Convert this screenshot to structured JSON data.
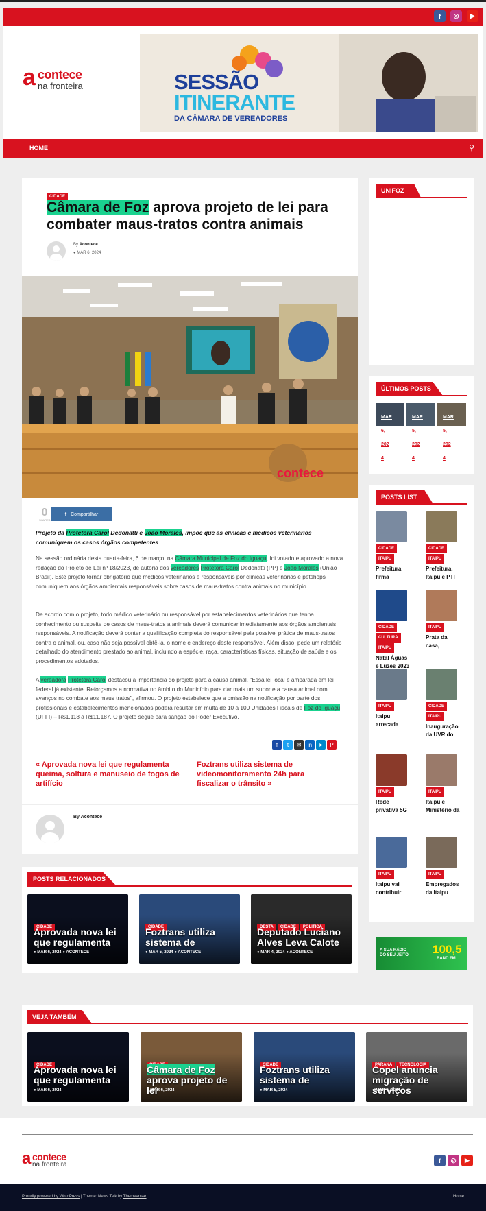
{
  "header": {
    "logo_line1": "contece",
    "logo_line2": "na fronteira",
    "banner": {
      "line1": "SESSÃO",
      "line2": "ITINERANTE",
      "line3": "DA CÂMARA DE VEREADORES"
    }
  },
  "nav": {
    "home": "HOME"
  },
  "article": {
    "category": "CIDADE",
    "title_hl": "Câmara de Foz",
    "title_rest": " aprova projeto de lei para combater maus-tratos contra animais",
    "author_prefix": "By",
    "author": "Acontece",
    "date": "MAR 6, 2024",
    "photo_watermark": "contece",
    "shares_count": "0",
    "shares_label": "SHARES",
    "share_button": "Compartilhar",
    "lead_1": "Projeto da ",
    "lead_hl1": "Protetora Carol",
    "lead_2": " Dedonatti e ",
    "lead_hl2": "João Morales",
    "lead_3": ", impõe que as clínicas e médicos veterinários comuniquem os casos órgãos competentes",
    "p1_a": "Na sessão ordinária desta quarta-feira, 6 de março, na ",
    "p1_hl1": "Câmara Municipal de Foz do Iguaçu",
    "p1_b": ", foi votado e aprovado a nova redação do Projeto de Lei nº 18/2023, de autoria dos ",
    "p1_hl2": "vereadores",
    "p1_hl3": "Protetora Carol",
    "p1_c": " Dedonatti (PP) e ",
    "p1_hl4": "João Morales",
    "p1_d": " (União Brasil). Este projeto tornar obrigatório que médicos veterinários e responsáveis por clínicas veterinárias e petshops comuniquem aos órgãos ambientais responsáveis sobre casos de maus-tratos contra animais no município.",
    "p2": "De acordo com o projeto, todo médico veterinário ou responsável por estabelecimentos veterinários que tenha conhecimento ou suspeite de casos de maus-tratos a animais deverá comunicar imediatamente aos órgãos ambientais responsáveis. A notificação deverá conter a qualificação completa do responsável pela possível prática de maus-tratos contra o animal, ou, caso não seja possível obtê-la, o nome e endereço deste responsável. Além disso, pede um relatório detalhado do atendimento prestado ao animal, incluindo a espécie, raça, características físicas, situação de saúde e os procedimentos adotados.",
    "p3_a": "A ",
    "p3_hl1": "vereadora",
    "p3_hl2": "Protetora Carol",
    "p3_b": " destacou a importância do projeto para a causa animal. \"Essa lei local é amparada em lei federal já existente. Reforçamos a normativa no âmbito do Município para dar mais um suporte a causa animal com avanços no combate aos maus tratos\", afirmou. O projeto estabelece que a omissão na notificação por parte dos profissionais e estabelecimentos mencionados poderá resultar em multa de 10 a 100 Unidades Fiscais de ",
    "p3_hl3": "Foz do Iguaçu",
    "p3_c": " (UFFI) – R$1.118 a R$11.187. O projeto segue para sanção do Poder Executivo.",
    "prev_link": "« Aprovada nova lei que regulamenta queima, soltura e manuseio de fogos de artifício",
    "next_link": "Foztrans utiliza sistema de videomonitoramento 24h para fiscalizar o trânsito »",
    "author_box": "By Acontece"
  },
  "sidebar": {
    "unifoz_title": "UNIFOZ",
    "ultimos_title": "ÚLTIMOS POSTS",
    "ultimos": [
      {
        "d1": "MAR",
        "d2": "6,",
        "d3": "202",
        "d4": "4"
      },
      {
        "d1": "MAR",
        "d2": "5,",
        "d3": "202",
        "d4": "4"
      },
      {
        "d1": "MAR",
        "d2": "5,",
        "d3": "202",
        "d4": "4"
      }
    ],
    "posts_list_title": "POSTS LIST",
    "posts_list": [
      {
        "tags": [
          "CIDADE",
          "ITAIPU"
        ],
        "title": "Prefeitura firma"
      },
      {
        "tags": [
          "CIDADE",
          "ITAIPU"
        ],
        "title": "Prefeitura, Itaipu e PTI"
      },
      {
        "tags": [
          "CIDADE",
          "CULTURA",
          "ITAIPU"
        ],
        "title": "Natal Águas e Luzes 2023"
      },
      {
        "tags": [
          "ITAIPU"
        ],
        "title": "Prata da casa,"
      },
      {
        "tags": [
          "ITAIPU"
        ],
        "title": "Itaipu arrecada"
      },
      {
        "tags": [
          "CIDADE",
          "ITAIPU"
        ],
        "title": "Inauguração da UVR do"
      },
      {
        "tags": [
          "ITAIPU"
        ],
        "title": "Rede privativa 5G"
      },
      {
        "tags": [
          "ITAIPU"
        ],
        "title": "Itaipu e Ministério da"
      },
      {
        "tags": [
          "ITAIPU"
        ],
        "title": "Itaipu vai contribuir"
      },
      {
        "tags": [
          "ITAIPU"
        ],
        "title": "Empregados da Itaipu"
      }
    ],
    "ad": {
      "line1": "A SUA RÁDIO",
      "line2": "DO SEU JEITO",
      "freq": "100,5",
      "band": "BAND FM"
    }
  },
  "related": {
    "title": "POSTS RELACIONADOS",
    "cards": [
      {
        "tags": [
          "CIDADE"
        ],
        "title": "Aprovada nova lei que regulamenta",
        "date": "MAR 6, 2024",
        "author": "ACONTECE"
      },
      {
        "tags": [
          "CIDADE"
        ],
        "title": "Foztrans utiliza sistema de",
        "date": "MAR 5, 2024",
        "author": "ACONTECE"
      },
      {
        "tags": [
          "DESTA",
          "CIDADE",
          "POLITICA"
        ],
        "title": "Deputado Luciano Alves Leva Calote",
        "date": "MAR 4, 2024",
        "author": "ACONTECE"
      }
    ]
  },
  "veja": {
    "title": "VEJA TAMBÉM",
    "cards": [
      {
        "tags": [
          "CIDADE"
        ],
        "title": "Aprovada nova lei que regulamenta",
        "date": "MAR 6, 2024"
      },
      {
        "tags": [
          "CIDADE"
        ],
        "title_hl": "Câmara de Foz",
        "title": "aprova projeto de lei",
        "date": "MAR 6, 2024"
      },
      {
        "tags": [
          "CIDADE"
        ],
        "title": "Foztrans utiliza sistema de",
        "date": "MAR 5, 2024"
      },
      {
        "tags": [
          "PARANA",
          "TECNOLOGIA"
        ],
        "title": "Copel anuncia migração de serviços",
        "date": "MAR 5, 2024"
      }
    ]
  },
  "footer": {
    "credit_a": "Proudly powered by WordPress",
    "credit_b": " | Theme: News Talk by ",
    "credit_c": "Themeansar",
    "home": "Home"
  }
}
